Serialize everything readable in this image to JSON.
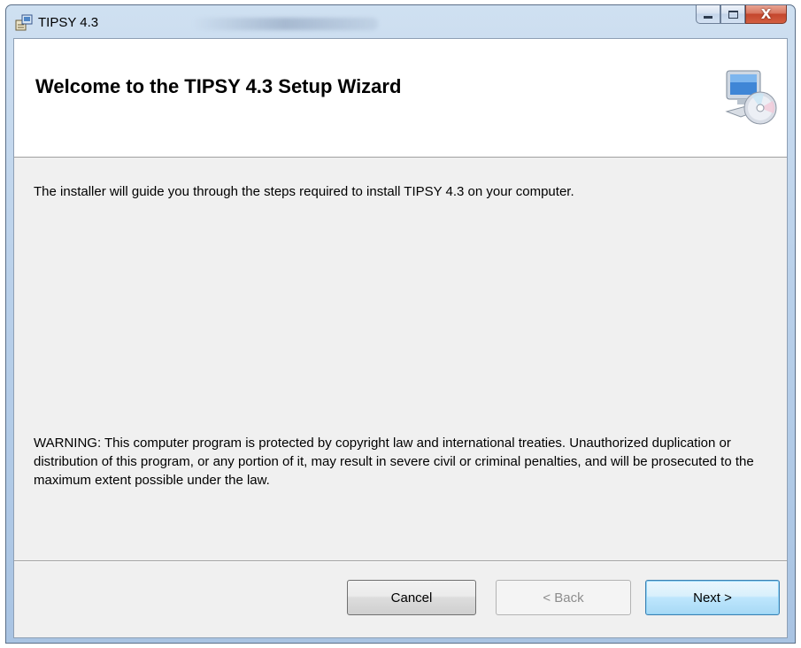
{
  "window": {
    "title": "TIPSY 4.3",
    "buttons": {
      "minimize_icon": "minimize-icon",
      "maximize_icon": "maximize-icon",
      "close_icon": "close-icon",
      "close_glyph": "X"
    }
  },
  "banner": {
    "title": "Welcome to the TIPSY 4.3 Setup Wizard",
    "icon": "computer-cd-icon"
  },
  "body": {
    "intro": "The installer will guide you through the steps required to install TIPSY 4.3 on your computer.",
    "warning": "WARNING: This computer program is protected by copyright law and international treaties. Unauthorized duplication or distribution of this program, or any portion of it, may result in severe civil or criminal penalties, and will be prosecuted to the maximum extent possible under the law."
  },
  "footer": {
    "cancel_label": "Cancel",
    "back_label": "< Back",
    "next_label": "Next >"
  },
  "colors": {
    "close_button": "#c4462d",
    "next_button_border": "#3c7fb1",
    "client_bg": "#f0f0f0"
  }
}
